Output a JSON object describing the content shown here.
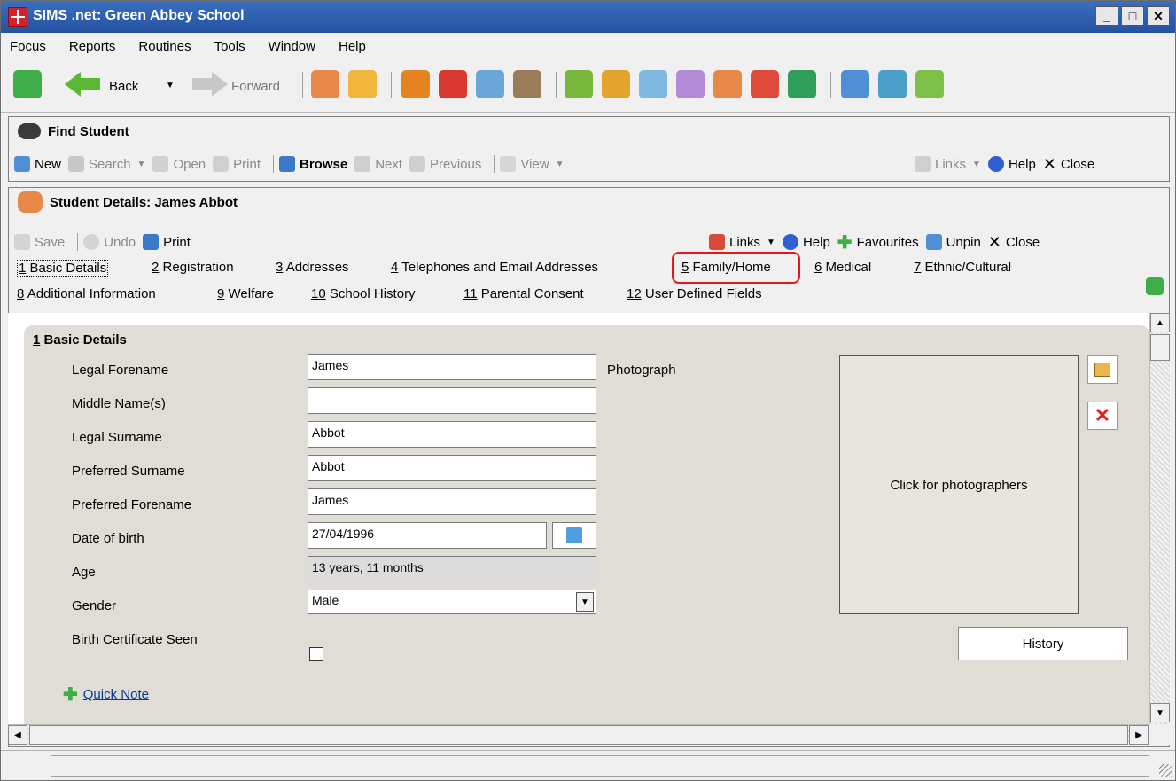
{
  "window": {
    "title": "SIMS .net: Green Abbey School"
  },
  "menu": [
    "Focus",
    "Reports",
    "Routines",
    "Tools",
    "Window",
    "Help"
  ],
  "main_toolbar": {
    "back": "Back",
    "forward": "Forward"
  },
  "find_panel": {
    "title": "Find Student",
    "toolbar": {
      "new": "New",
      "search": "Search",
      "open": "Open",
      "print": "Print",
      "browse": "Browse",
      "next": "Next",
      "previous": "Previous",
      "view": "View",
      "links": "Links",
      "help": "Help",
      "close": "Close"
    }
  },
  "details_panel": {
    "title": "Student Details: James Abbot",
    "toolbar": {
      "save": "Save",
      "undo": "Undo",
      "print": "Print",
      "links": "Links",
      "help": "Help",
      "favourites": "Favourites",
      "unpin": "Unpin",
      "close": "Close"
    },
    "tabs": [
      {
        "key": "1",
        "label": "Basic Details"
      },
      {
        "key": "2",
        "label": "Registration"
      },
      {
        "key": "3",
        "label": "Addresses"
      },
      {
        "key": "4",
        "label": "Telephones and Email Addresses"
      },
      {
        "key": "5",
        "label": "Family/Home"
      },
      {
        "key": "6",
        "label": "Medical"
      },
      {
        "key": "7",
        "label": "Ethnic/Cultural"
      },
      {
        "key": "8",
        "label": "Additional Information"
      },
      {
        "key": "9",
        "label": "Welfare"
      },
      {
        "key": "10",
        "label": "School History"
      },
      {
        "key": "11",
        "label": "Parental Consent"
      },
      {
        "key": "12",
        "label": "User Defined Fields"
      }
    ]
  },
  "section": {
    "title_key": "1",
    "title": "Basic Details",
    "fields": {
      "legal_forename": {
        "label": "Legal Forename",
        "value": "James"
      },
      "middle_names": {
        "label": "Middle Name(s)",
        "value": ""
      },
      "legal_surname": {
        "label": "Legal Surname",
        "value": "Abbot"
      },
      "preferred_surname": {
        "label": "Preferred Surname",
        "value": "Abbot"
      },
      "preferred_forename": {
        "label": "Preferred Forename",
        "value": "James"
      },
      "dob": {
        "label": "Date of birth",
        "value": "27/04/1996"
      },
      "age": {
        "label": "Age",
        "value": "13 years, 11 months"
      },
      "gender": {
        "label": "Gender",
        "value": "Male"
      },
      "birth_cert": {
        "label": "Birth Certificate Seen"
      }
    },
    "photo_label": "Photograph",
    "photo_text": "Click for photographers",
    "history": "History",
    "quick_note": "Quick Note"
  }
}
